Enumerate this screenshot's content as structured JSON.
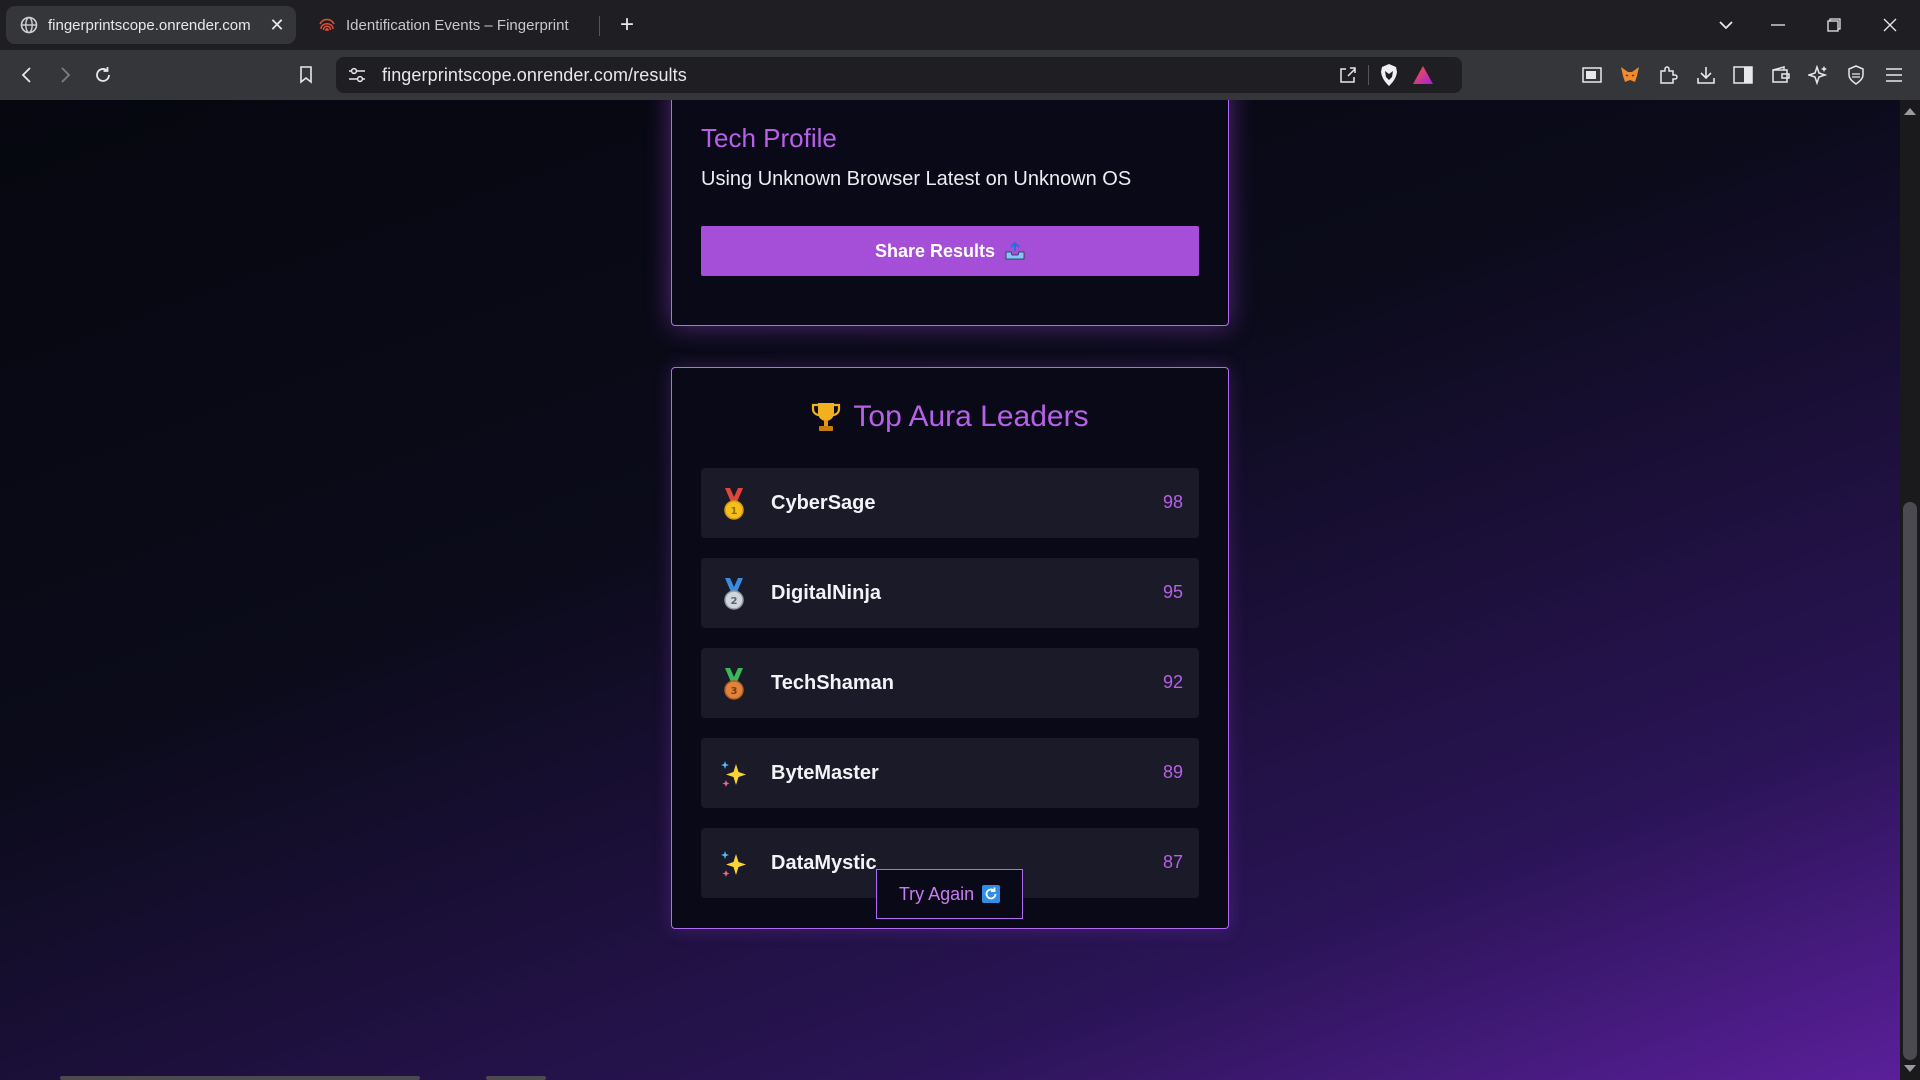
{
  "browser": {
    "tabs": [
      {
        "title": "fingerprintscope.onrender.com",
        "active": true
      },
      {
        "title": "Identification Events – Fingerprint",
        "active": false
      }
    ],
    "address": "fingerprintscope.onrender.com/results"
  },
  "profile": {
    "heading": "Tech Profile",
    "description": "Using Unknown Browser Latest on Unknown OS",
    "share_label": "Share Results"
  },
  "leaders": {
    "heading": "Top Aura Leaders",
    "rows": [
      {
        "name": "CyberSage",
        "score": "98",
        "icon": "gold-medal-icon"
      },
      {
        "name": "DigitalNinja",
        "score": "95",
        "icon": "silver-medal-icon"
      },
      {
        "name": "TechShaman",
        "score": "92",
        "icon": "bronze-medal-icon"
      },
      {
        "name": "ByteMaster",
        "score": "89",
        "icon": "sparkles-icon"
      },
      {
        "name": "DataMystic",
        "score": "87",
        "icon": "sparkles-icon"
      }
    ]
  },
  "try_again_label": "Try Again",
  "colors": {
    "accent": "#b760e8",
    "button": "#a54fd9",
    "card_bg": "#0a0917",
    "row_bg": "#1a1a29"
  }
}
